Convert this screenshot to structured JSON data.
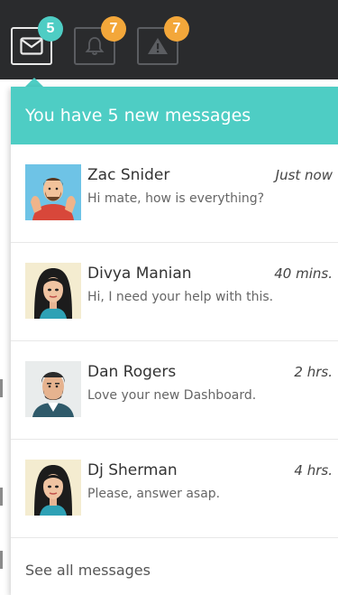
{
  "topbar": {
    "icons": [
      {
        "icon": "envelope-icon",
        "badge": "5",
        "badge_color": "#4ecdc4",
        "active": true
      },
      {
        "icon": "bell-icon",
        "badge": "7",
        "badge_color": "#f3a73a",
        "active": false
      },
      {
        "icon": "warning-icon",
        "badge": "7",
        "badge_color": "#f3a73a",
        "active": false
      }
    ]
  },
  "dropdown": {
    "header": "You have 5 new messages",
    "accent_color": "#4ecdc4",
    "messages": [
      {
        "name": "Zac Snider",
        "time": "Just now",
        "preview": "Hi mate, how is everything?"
      },
      {
        "name": "Divya Manian",
        "time": "40 mins.",
        "preview": "Hi, I need your help with this."
      },
      {
        "name": "Dan Rogers",
        "time": "2 hrs.",
        "preview": "Love your new Dashboard."
      },
      {
        "name": "Dj Sherman",
        "time": "4 hrs.",
        "preview": "Please, answer asap."
      }
    ],
    "footer_link": "See all messages"
  }
}
